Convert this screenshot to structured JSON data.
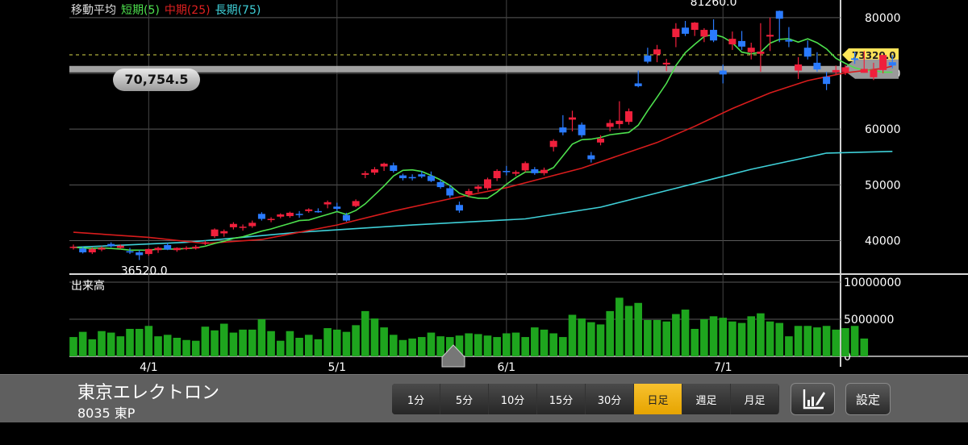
{
  "legend": {
    "title": "移動平均",
    "short": "短期(5)",
    "mid": "中期(25)",
    "long": "長期(75)"
  },
  "colors": {
    "up": "#f0203c",
    "down": "#2a7bff",
    "short_ma": "#4de04d",
    "mid_ma": "#d81c1c",
    "long_ma": "#3fd0d8",
    "volume": "#1ea51e",
    "active_tab": "#f5b800"
  },
  "cursor": {
    "value": "70,754.5"
  },
  "volume_panel": {
    "label": "出来高"
  },
  "stock": {
    "name": "東京エレクトロン",
    "code": "8035 東P"
  },
  "timeframes": [
    {
      "label": "1分",
      "active": false
    },
    {
      "label": "5分",
      "active": false
    },
    {
      "label": "10分",
      "active": false
    },
    {
      "label": "15分",
      "active": false
    },
    {
      "label": "30分",
      "active": false
    },
    {
      "label": "日足",
      "active": true
    },
    {
      "label": "週足",
      "active": false
    },
    {
      "label": "月足",
      "active": false
    }
  ],
  "settings_label": "設定",
  "tool_icon": "chart-edit-icon",
  "chart_data": {
    "type": "candlestick",
    "price_axis": {
      "ticks": [
        "80000",
        "70000",
        "60000",
        "50000",
        "40000"
      ],
      "ylim": [
        34000,
        82000
      ]
    },
    "volume_axis": {
      "ticks": [
        "10000000",
        "5000000",
        "0"
      ],
      "ylim": [
        0,
        10000000
      ]
    },
    "x_labels": [
      "4/1",
      "5/1",
      "6/1",
      "7/1"
    ],
    "x_label_index": [
      8,
      28,
      46,
      69
    ],
    "current_price": "73320.0",
    "annotations": {
      "high": "81260.0",
      "low": "36520.0",
      "high_index": 68,
      "low_index": 7
    },
    "ohlc": [
      [
        38800,
        39300,
        38400,
        38900
      ],
      [
        38600,
        38900,
        37700,
        37900
      ],
      [
        37900,
        38800,
        37600,
        38500
      ],
      [
        38400,
        39000,
        38100,
        38700
      ],
      [
        39400,
        39700,
        38800,
        39000
      ],
      [
        38700,
        39300,
        38500,
        39100
      ],
      [
        38100,
        38700,
        37600,
        37900
      ],
      [
        37900,
        38300,
        36520,
        37400
      ],
      [
        37600,
        38600,
        37300,
        38500
      ],
      [
        38300,
        38900,
        37800,
        38700
      ],
      [
        39200,
        39600,
        38300,
        38400
      ],
      [
        38300,
        38800,
        38000,
        38700
      ],
      [
        38700,
        39000,
        38300,
        38700
      ],
      [
        38600,
        39200,
        38400,
        38900
      ],
      [
        39500,
        40000,
        39200,
        39700
      ],
      [
        40800,
        42200,
        40500,
        42000
      ],
      [
        41300,
        42000,
        40700,
        41700
      ],
      [
        42400,
        43300,
        42000,
        43000
      ],
      [
        42300,
        42900,
        41800,
        42500
      ],
      [
        42600,
        43600,
        42300,
        43200
      ],
      [
        44800,
        45100,
        43600,
        43900
      ],
      [
        43700,
        44200,
        43300,
        43900
      ],
      [
        44300,
        44900,
        44000,
        44700
      ],
      [
        44400,
        45200,
        44100,
        45000
      ],
      [
        44800,
        45300,
        44100,
        44700
      ],
      [
        45300,
        45800,
        45000,
        45600
      ],
      [
        45300,
        45800,
        45000,
        45100
      ],
      [
        46500,
        47200,
        45800,
        46900
      ],
      [
        46100,
        46800,
        45300,
        45700
      ],
      [
        44600,
        45000,
        43400,
        43600
      ],
      [
        46200,
        47400,
        46000,
        47100
      ],
      [
        51800,
        52500,
        51200,
        52100
      ],
      [
        52200,
        53200,
        51800,
        52800
      ],
      [
        53300,
        54000,
        52500,
        53800
      ],
      [
        53500,
        54000,
        52200,
        52500
      ],
      [
        51700,
        52000,
        50800,
        51200
      ],
      [
        51400,
        51900,
        50800,
        51300
      ],
      [
        51900,
        52500,
        51200,
        51500
      ],
      [
        51600,
        52400,
        50500,
        50700
      ],
      [
        50500,
        51000,
        49300,
        49600
      ],
      [
        49400,
        50000,
        47700,
        48100
      ],
      [
        46400,
        47000,
        45000,
        45400
      ],
      [
        48300,
        49300,
        47800,
        48900
      ],
      [
        49300,
        50000,
        48700,
        49700
      ],
      [
        49400,
        51300,
        49100,
        51000
      ],
      [
        51200,
        52800,
        50700,
        52500
      ],
      [
        52500,
        53400,
        51700,
        52300
      ],
      [
        52000,
        52600,
        51600,
        52300
      ],
      [
        52600,
        54200,
        52300,
        53900
      ],
      [
        52800,
        53200,
        51800,
        52100
      ],
      [
        52100,
        53100,
        51700,
        52700
      ],
      [
        56800,
        58200,
        56000,
        57900
      ],
      [
        60300,
        62500,
        58900,
        59400
      ],
      [
        61700,
        63300,
        59600,
        62100
      ],
      [
        60800,
        61200,
        58500,
        58900
      ],
      [
        55300,
        55900,
        54000,
        54600
      ],
      [
        57600,
        58900,
        57100,
        58300
      ],
      [
        60400,
        61700,
        59600,
        61100
      ],
      [
        60900,
        65000,
        60100,
        61500
      ],
      [
        61300,
        63700,
        60800,
        63200
      ],
      [
        68200,
        70500,
        67500,
        67700
      ],
      [
        73200,
        74600,
        71800,
        72100
      ],
      [
        73400,
        75100,
        72000,
        74300
      ],
      [
        71600,
        72600,
        70400,
        71900
      ],
      [
        76500,
        79000,
        74700,
        78000
      ],
      [
        78200,
        79400,
        76700,
        77100
      ],
      [
        77800,
        79200,
        76700,
        79100
      ],
      [
        76600,
        78100,
        75600,
        77800
      ],
      [
        77800,
        79700,
        75600,
        75900
      ],
      [
        70500,
        71600,
        68200,
        69800
      ],
      [
        75200,
        77500,
        74200,
        76200
      ],
      [
        75800,
        77600,
        74200,
        74800
      ],
      [
        73800,
        75500,
        72500,
        74600
      ],
      [
        73500,
        79000,
        70300,
        73900
      ],
      [
        76600,
        80000,
        74000,
        76900
      ],
      [
        81200,
        81260,
        75600,
        79800
      ],
      [
        76000,
        78300,
        74700,
        75700
      ],
      [
        70500,
        72900,
        69000,
        71600
      ],
      [
        74600,
        75900,
        72500,
        73000
      ],
      [
        71900,
        73800,
        70300,
        70700
      ],
      [
        69400,
        70300,
        67000,
        68100
      ],
      [
        70200,
        71400,
        69800,
        70600
      ],
      [
        70200,
        71500,
        69700,
        71100
      ],
      [
        72700,
        73900,
        71700,
        72400
      ],
      [
        70100,
        74000,
        70100,
        70800
      ],
      [
        69300,
        71900,
        68800,
        70600
      ],
      [
        70600,
        73000,
        70000,
        73300
      ],
      [
        72000,
        73300,
        70900,
        71400
      ]
    ],
    "ma_short": [
      38800,
      38700,
      38600,
      38700,
      38600,
      38500,
      38300,
      38300,
      38300,
      38500,
      38500,
      38500,
      38600,
      38700,
      39000,
      39500,
      39900,
      40400,
      40700,
      41200,
      41700,
      42100,
      42600,
      43100,
      43600,
      43700,
      44200,
      44700,
      45200,
      44700,
      45400,
      46600,
      48200,
      49800,
      51600,
      52600,
      52700,
      52400,
      51700,
      50900,
      49900,
      48500,
      47900,
      47600,
      47600,
      48700,
      50100,
      51300,
      52300,
      52300,
      52300,
      53100,
      55200,
      57300,
      58100,
      58200,
      58500,
      59000,
      59200,
      59400,
      60700,
      63300,
      65700,
      68200,
      71400,
      73700,
      75200,
      76600,
      77000,
      76500,
      75500,
      73800,
      73500,
      73800,
      75400,
      76100,
      76200,
      75600,
      76200,
      75500,
      74400,
      72700,
      71800,
      71000,
      70600,
      70500,
      70200,
      70200
    ]
  },
  "mid_ma_curve": [
    [
      0,
      41500
    ],
    [
      8,
      40600
    ],
    [
      14,
      39500
    ],
    [
      20,
      40200
    ],
    [
      28,
      42800
    ],
    [
      34,
      45300
    ],
    [
      40,
      47500
    ],
    [
      46,
      49500
    ],
    [
      54,
      53000
    ],
    [
      62,
      57600
    ],
    [
      66,
      60500
    ],
    [
      70,
      63700
    ],
    [
      74,
      66500
    ],
    [
      78,
      68700
    ],
    [
      82,
      70100
    ],
    [
      86,
      70900
    ],
    [
      87,
      71300
    ]
  ],
  "long_ma_curve": [
    [
      0,
      38800
    ],
    [
      12,
      39700
    ],
    [
      24,
      41500
    ],
    [
      36,
      42800
    ],
    [
      48,
      43900
    ],
    [
      56,
      46000
    ],
    [
      64,
      49400
    ],
    [
      72,
      52800
    ],
    [
      80,
      55700
    ],
    [
      87,
      56000
    ]
  ]
}
